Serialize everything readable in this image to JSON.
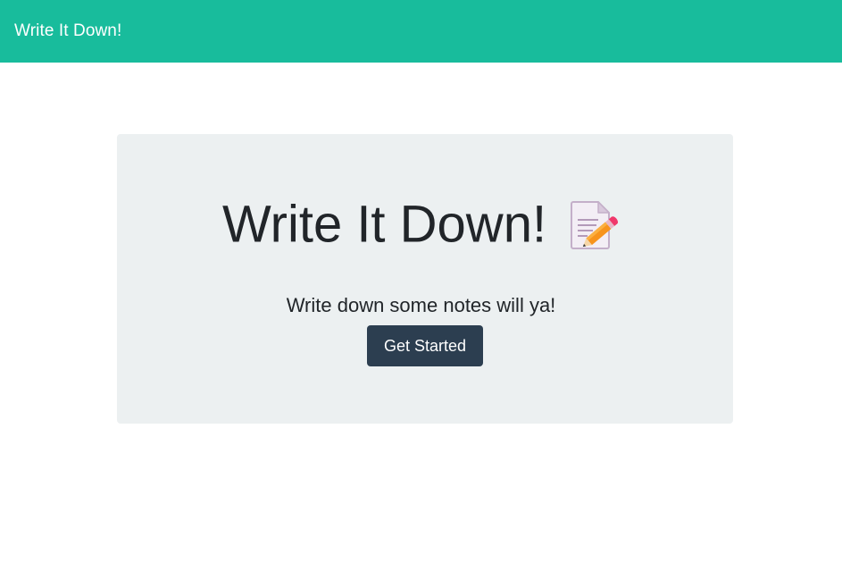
{
  "navbar": {
    "brand": "Write It Down!",
    "background": "#18bc9c"
  },
  "hero": {
    "title": "Write It Down!",
    "icon": "memo-pencil-icon",
    "subtitle": "Write down some notes will ya!",
    "button_label": "Get Started",
    "button_color": "#2c3e50",
    "panel_color": "#ecf0f1"
  }
}
